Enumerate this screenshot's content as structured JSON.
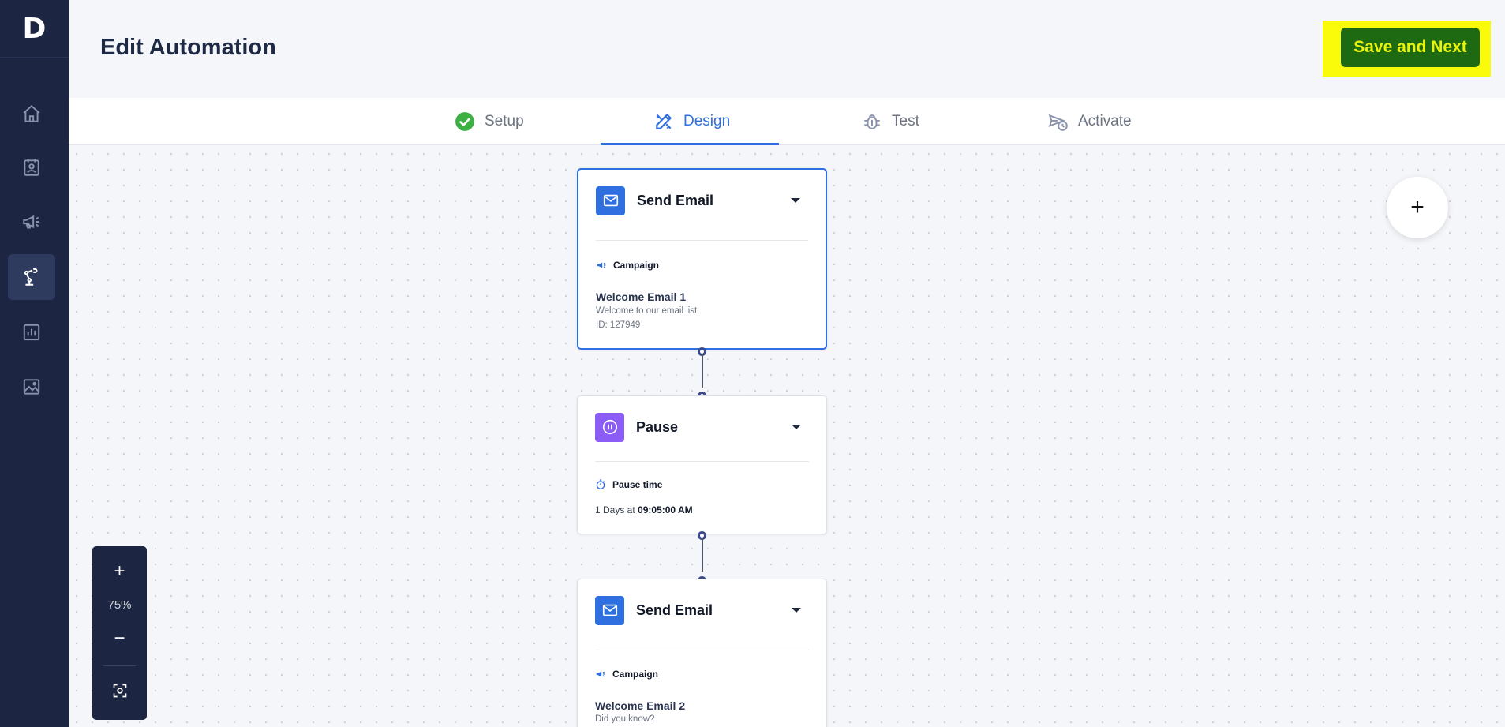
{
  "sidebar": {
    "logo": "D",
    "items": [
      {
        "icon": "home-icon",
        "active": false
      },
      {
        "icon": "contacts-icon",
        "active": false
      },
      {
        "icon": "megaphone-icon",
        "active": false
      },
      {
        "icon": "robot-arm-icon",
        "active": true
      },
      {
        "icon": "chart-icon",
        "active": false
      },
      {
        "icon": "image-icon",
        "active": false
      }
    ]
  },
  "header": {
    "title": "Edit Automation",
    "save_label": "Save and Next"
  },
  "tabs": [
    {
      "label": "Setup",
      "icon": "check-circle-icon",
      "state": "done"
    },
    {
      "label": "Design",
      "icon": "design-tools-icon",
      "state": "active"
    },
    {
      "label": "Test",
      "icon": "bug-icon",
      "state": "pending"
    },
    {
      "label": "Activate",
      "icon": "send-clock-icon",
      "state": "pending"
    }
  ],
  "nodes": [
    {
      "type": "Send Email",
      "sub_label": "Campaign",
      "name": "Welcome Email 1",
      "description": "Welcome to our email list",
      "id": "ID: 127949"
    },
    {
      "type": "Pause",
      "sub_label": "Pause time",
      "text_prefix": "1 Days at",
      "text_bold": "09:05:00 AM"
    },
    {
      "type": "Send Email",
      "sub_label": "Campaign",
      "name": "Welcome Email 2",
      "description": "Did you know?"
    }
  ],
  "canvas": {
    "add_label": "+",
    "zoom": {
      "plus": "+",
      "level": "75%",
      "minus": "−"
    }
  },
  "colors": {
    "sidebar": "#1c2541",
    "accent": "#2f6fe0",
    "save_button": "#1e6a12",
    "save_text": "#eaf30a",
    "highlight": "#f9fb0b",
    "pause": "#8b5cf6",
    "success": "#3cb043"
  }
}
